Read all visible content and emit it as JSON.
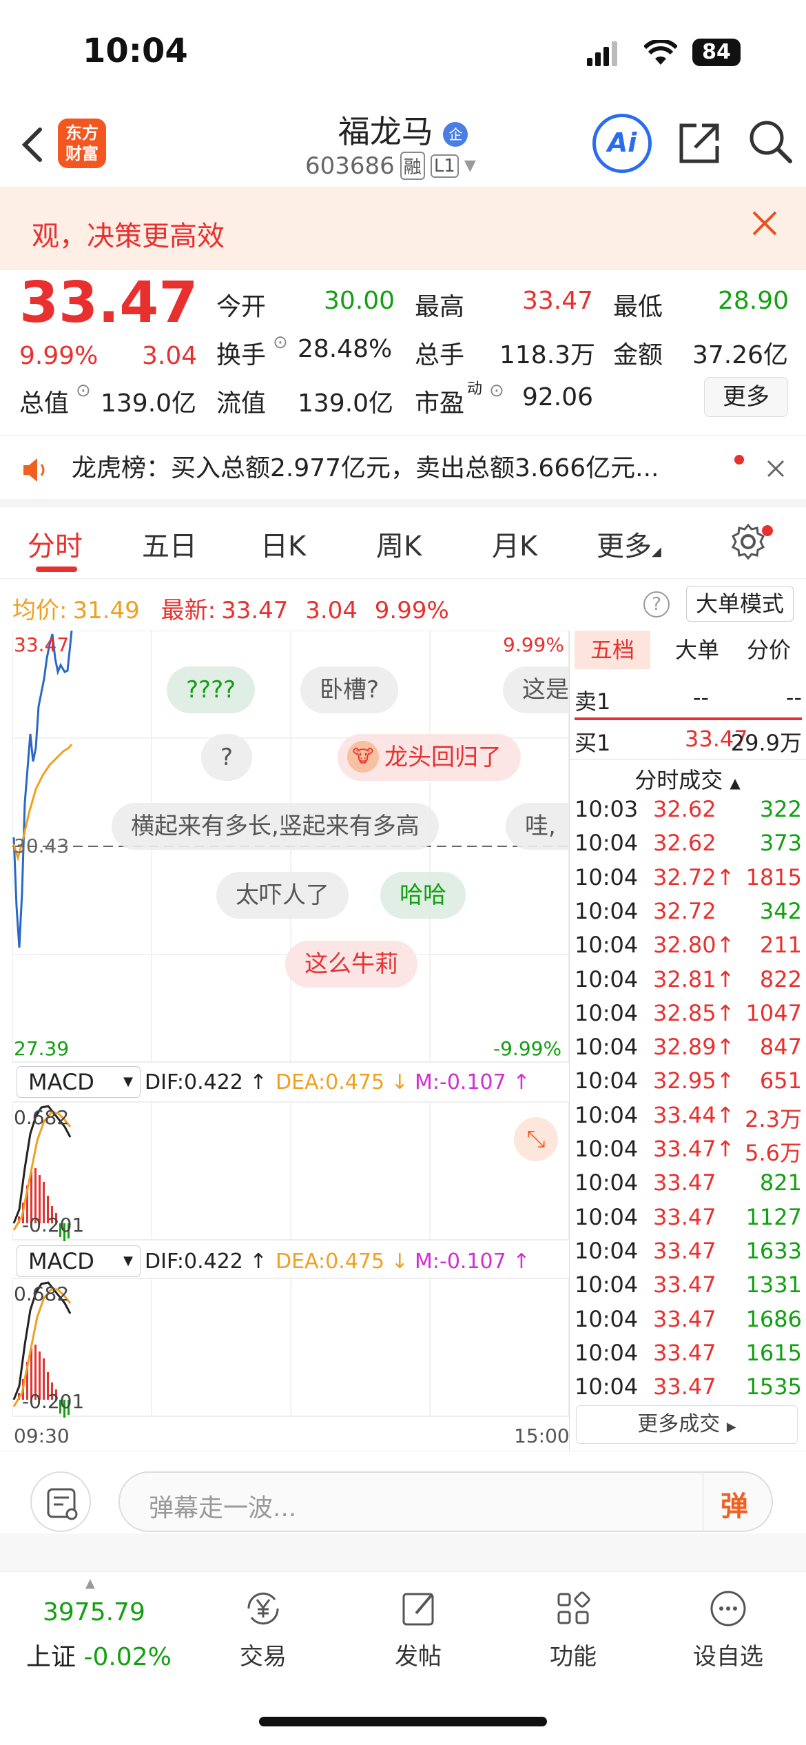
{
  "status_bar": {
    "time": "10:04",
    "battery": "84"
  },
  "header": {
    "logo_text_1": "东方",
    "logo_text_2": "财富",
    "stock_name": "福龙马",
    "badge": "企",
    "code": "603686",
    "tag_margin": "融",
    "tag_level": "L1",
    "ai_label": "Ai"
  },
  "banner": {
    "text": "观，决策更高效"
  },
  "quote": {
    "price": "33.47",
    "change_pct": "9.99%",
    "change": "3.04",
    "open_label": "今开",
    "open": "30.00",
    "high_label": "最高",
    "high": "33.47",
    "low_label": "最低",
    "low": "28.90",
    "turnover_label": "换手",
    "turnover": "28.48%",
    "volume_label": "总手",
    "volume": "118.3万",
    "amount_label": "金额",
    "amount": "37.26亿",
    "mktcap_label": "总值",
    "mktcap": "139.0亿",
    "float_label": "流值",
    "float_cap": "139.0亿",
    "pe_label": "市盈",
    "pe_sup": "动",
    "pe": "92.06",
    "more_label": "更多"
  },
  "dragon": {
    "text": "龙虎榜：买入总额2.977亿元，卖出总额3.666亿元..."
  },
  "tabs": [
    "分时",
    "五日",
    "日K",
    "周K",
    "月K",
    "更多"
  ],
  "avg_line": {
    "avg_label": "均价:",
    "avg": "31.49",
    "latest_label": "最新:",
    "latest": "33.47",
    "chg": "3.04",
    "pct": "9.99%",
    "big_mode": "大单模式"
  },
  "chart_labels": {
    "top_left": "33.47",
    "top_right": "9.99%",
    "mid": "30.43",
    "bottom_left": "27.39",
    "bottom_right": "-9.99%",
    "time_start": "09:30",
    "time_end": "15:00"
  },
  "danmu": [
    "????",
    "卧槽?",
    "这是",
    "?",
    "龙头回归了",
    "横起来有多长,竖起来有多高",
    "哇,",
    "太吓人了",
    "哈哈",
    "这么牛莉"
  ],
  "macd": {
    "name": "MACD",
    "dif": "DIF:0.422 ↑",
    "dea": "DEA:0.475 ↓",
    "m": "M:-0.107 ↑",
    "top": "0.682",
    "bottom": "-0.201"
  },
  "book": {
    "tabs": [
      "五档",
      "大单",
      "分价"
    ],
    "sell1": {
      "label": "卖1",
      "price": "--",
      "vol": "--"
    },
    "buy1": {
      "label": "买1",
      "price": "33.47",
      "vol": "29.9万"
    },
    "ticks_title": "分时成交",
    "ticks": [
      {
        "t": "10:03",
        "p": "32.62",
        "v": "322",
        "c": "green"
      },
      {
        "t": "10:04",
        "p": "32.62",
        "v": "373",
        "c": "green"
      },
      {
        "t": "10:04",
        "p": "32.72↑",
        "v": "1815",
        "c": "red"
      },
      {
        "t": "10:04",
        "p": "32.72",
        "v": "342",
        "c": "green"
      },
      {
        "t": "10:04",
        "p": "32.80↑",
        "v": "211",
        "c": "red"
      },
      {
        "t": "10:04",
        "p": "32.81↑",
        "v": "822",
        "c": "red"
      },
      {
        "t": "10:04",
        "p": "32.85↑",
        "v": "1047",
        "c": "red"
      },
      {
        "t": "10:04",
        "p": "32.89↑",
        "v": "847",
        "c": "red"
      },
      {
        "t": "10:04",
        "p": "32.95↑",
        "v": "651",
        "c": "red"
      },
      {
        "t": "10:04",
        "p": "33.44↑",
        "v": "2.3万",
        "c": "red"
      },
      {
        "t": "10:04",
        "p": "33.47↑",
        "v": "5.6万",
        "c": "red"
      },
      {
        "t": "10:04",
        "p": "33.47",
        "v": "821",
        "c": "green"
      },
      {
        "t": "10:04",
        "p": "33.47",
        "v": "1127",
        "c": "green"
      },
      {
        "t": "10:04",
        "p": "33.47",
        "v": "1633",
        "c": "green"
      },
      {
        "t": "10:04",
        "p": "33.47",
        "v": "1331",
        "c": "green"
      },
      {
        "t": "10:04",
        "p": "33.47",
        "v": "1686",
        "c": "green"
      },
      {
        "t": "10:04",
        "p": "33.47",
        "v": "1615",
        "c": "green"
      },
      {
        "t": "10:04",
        "p": "33.47",
        "v": "1535",
        "c": "green"
      }
    ],
    "more_ticks": "更多成交"
  },
  "comment": {
    "placeholder": "弹幕走一波...",
    "danmu_btn": "弹"
  },
  "tabbar": {
    "index_value": "3975.79",
    "index_name": "上证",
    "index_pct": "-0.02%",
    "items": [
      "交易",
      "发帖",
      "功能",
      "设自选"
    ]
  }
}
